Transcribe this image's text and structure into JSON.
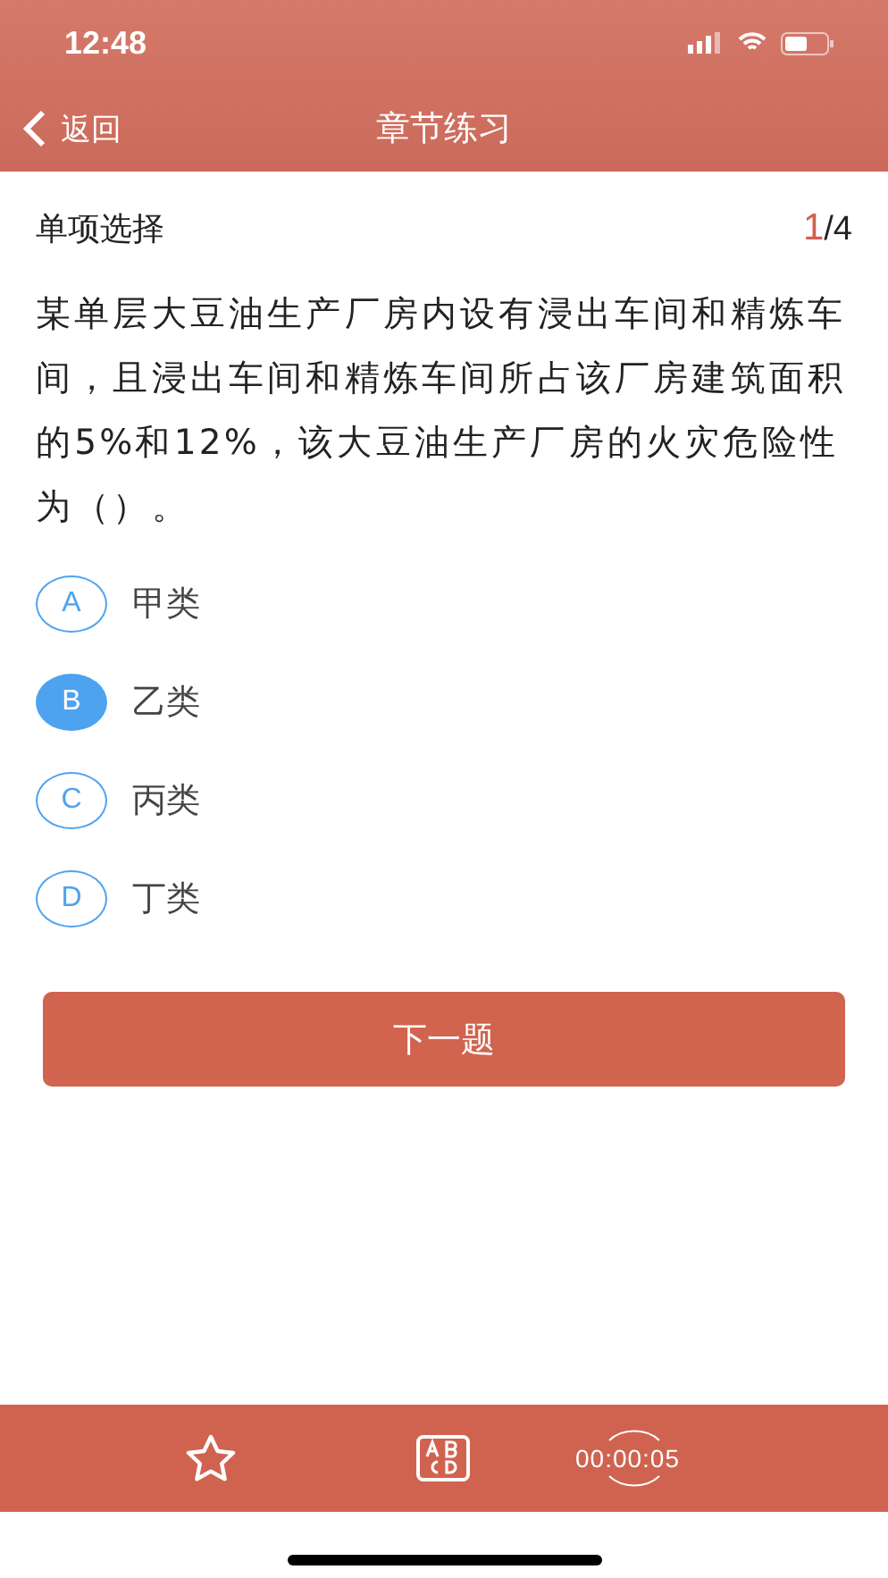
{
  "status_bar": {
    "time": "12:48"
  },
  "nav": {
    "back": "返回",
    "title": "章节练习"
  },
  "question": {
    "type": "单项选择",
    "counter": {
      "current": "1",
      "rest": "/4"
    },
    "text": "某单层大豆油生产厂房内设有浸出车间和精炼车间，且浸出车间和精炼车间所占该厂房建筑面积的5%和12%，该大豆油生产厂房的火灾危险性为（）。"
  },
  "options": [
    {
      "letter": "A",
      "text": "甲类",
      "selected": false
    },
    {
      "letter": "B",
      "text": "乙类",
      "selected": true
    },
    {
      "letter": "C",
      "text": "丙类",
      "selected": false
    },
    {
      "letter": "D",
      "text": "丁类",
      "selected": false
    }
  ],
  "next_button": "下一题",
  "toolbar": {
    "timer": "00:00:05"
  }
}
